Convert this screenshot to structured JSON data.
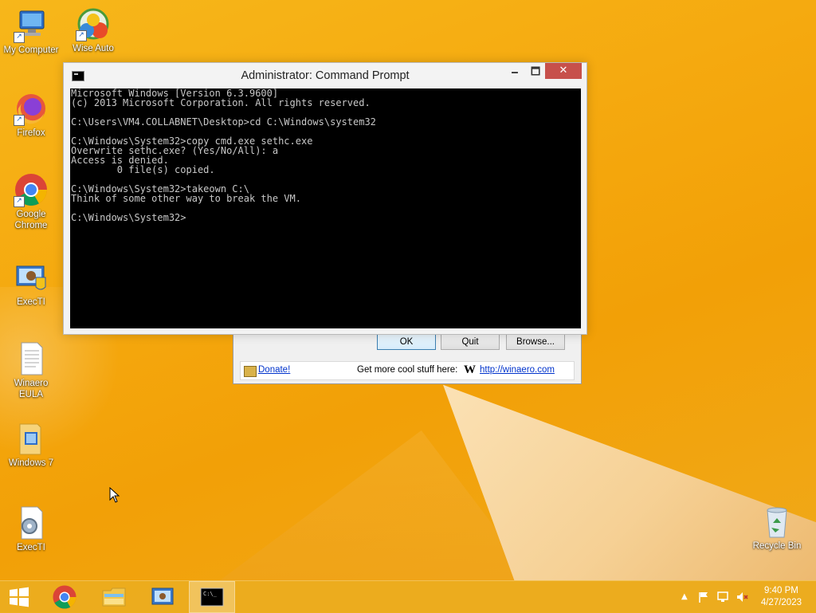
{
  "desktop": {
    "icons": [
      {
        "label": "My Computer",
        "icon": "computer-icon"
      },
      {
        "label": "Wise Auto Shutdown",
        "icon": "clock-shutdown-icon"
      },
      {
        "label": "Firefox",
        "icon": "firefox-icon"
      },
      {
        "label": "Google Chrome",
        "icon": "chrome-icon"
      },
      {
        "label": "ExecTI",
        "icon": "execti-icon"
      },
      {
        "label": "Winaero EULA",
        "icon": "document-icon"
      },
      {
        "label": "Windows 7",
        "icon": "folder-icon"
      },
      {
        "label": "ExecTI",
        "icon": "gear-document-icon"
      },
      {
        "label": "Recycle Bin",
        "icon": "recycle-bin-icon"
      }
    ]
  },
  "cmd": {
    "title": "Administrator:  Command Prompt",
    "minimize": "🗕",
    "maximize": "🗖",
    "close": "✕",
    "lines": [
      "Microsoft Windows [Version 6.3.9600]",
      "(c) 2013 Microsoft Corporation. All rights reserved.",
      "",
      "C:\\Users\\VM4.COLLABNET\\Desktop>cd C:\\Windows\\system32",
      "",
      "C:\\Windows\\System32>copy cmd.exe sethc.exe",
      "Overwrite sethc.exe? (Yes/No/All): a",
      "Access is denied.",
      "        0 file(s) copied.",
      "",
      "C:\\Windows\\System32>takeown C:\\",
      "Think of some other way to break the VM.",
      "",
      "C:\\Windows\\System32>"
    ]
  },
  "winaero": {
    "ok": "OK",
    "quit": "Quit",
    "browse": "Browse...",
    "donate": "Donate!",
    "more": "Get more cool stuff here:",
    "w": "W",
    "link": "http://winaero.com"
  },
  "taskbar": {
    "time": "9:40 PM",
    "date": "4/27/2023",
    "apps": [
      "start-icon",
      "chrome-icon",
      "file-explorer-icon",
      "execti-icon",
      "command-prompt-icon"
    ],
    "active_app": "command-prompt-icon"
  },
  "colors": {
    "desktop": "#f5a90f",
    "console_bg": "#000000",
    "console_fg": "#c8c8c8",
    "close_button": "#c7504b"
  }
}
